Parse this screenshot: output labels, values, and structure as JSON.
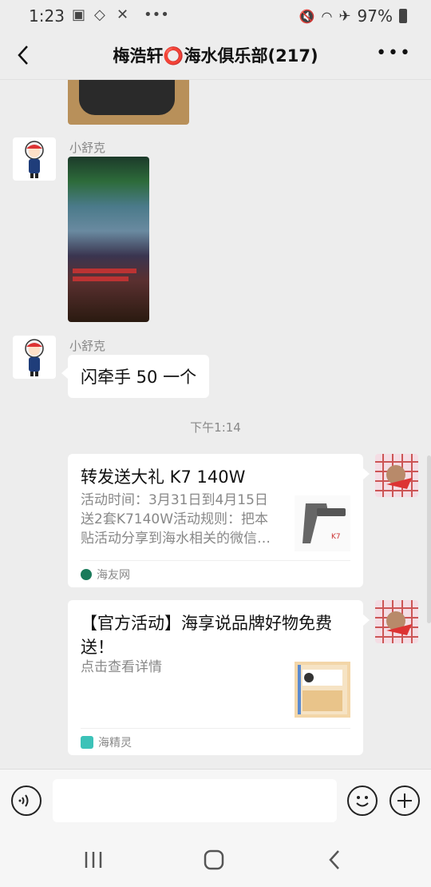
{
  "status_bar": {
    "time": "1:23",
    "battery": "97%"
  },
  "header": {
    "title": "梅浩轩⭕海水俱乐部(217)"
  },
  "messages": {
    "sender1": "小舒克",
    "sender2": "小舒克",
    "text2": "闪牵手 50 一个",
    "timestamp": "下午1:14",
    "card1": {
      "title": "转发送大礼 K7 140W",
      "desc": "活动时间：3月31日到4月15日送2套K7140W活动规则：把本贴活动分享到海水相关的微信…",
      "source": "海友网"
    },
    "card2": {
      "title": "【官方活动】海享说品牌好物免费送！",
      "desc": "点击查看详情",
      "source": "海精灵"
    }
  },
  "colors": {
    "bg": "#ededed",
    "bubble": "#ffffff",
    "muted": "#888888"
  }
}
